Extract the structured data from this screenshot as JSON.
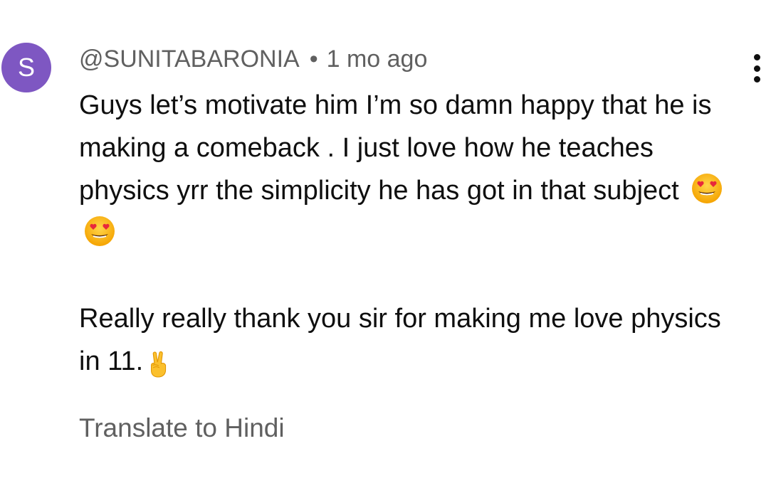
{
  "comment": {
    "avatar_letter": "S",
    "avatar_color": "#7e57c2",
    "author": "@SUNITABARONIA",
    "separator": "•",
    "time": "1 mo ago",
    "body": {
      "para1_text": "Guys let’s motivate him I’m so damn happy that he is making a comeback . I just love how he teaches physics yrr the simplicity he has got in that subject",
      "para1_emojis": [
        "😍",
        "😍"
      ],
      "para2_text": "Really really thank you sir for making me love physics in 11.",
      "para2_emoji": "✌️"
    },
    "translate_label": "Translate to Hindi",
    "menu_icon": "more-vertical-icon"
  }
}
